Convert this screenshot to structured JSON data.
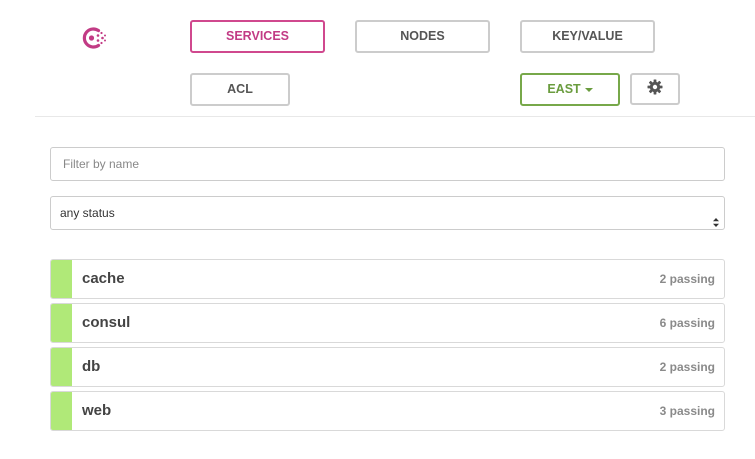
{
  "brand": {
    "logo_icon": "consul-logo-icon",
    "accent_color": "#c23b85"
  },
  "nav": {
    "services": "SERVICES",
    "nodes": "NODES",
    "key_value": "KEY/VALUE",
    "acl": "ACL",
    "datacenter": "EAST",
    "settings_icon": "gear-icon"
  },
  "filter": {
    "placeholder": "Filter by name",
    "value": ""
  },
  "status_select": {
    "selected": "any status"
  },
  "services": [
    {
      "name": "cache",
      "checks": "2 passing",
      "status_color": "#b0e978"
    },
    {
      "name": "consul",
      "checks": "6 passing",
      "status_color": "#b0e978"
    },
    {
      "name": "db",
      "checks": "2 passing",
      "status_color": "#b0e978"
    },
    {
      "name": "web",
      "checks": "3 passing",
      "status_color": "#b0e978"
    }
  ]
}
